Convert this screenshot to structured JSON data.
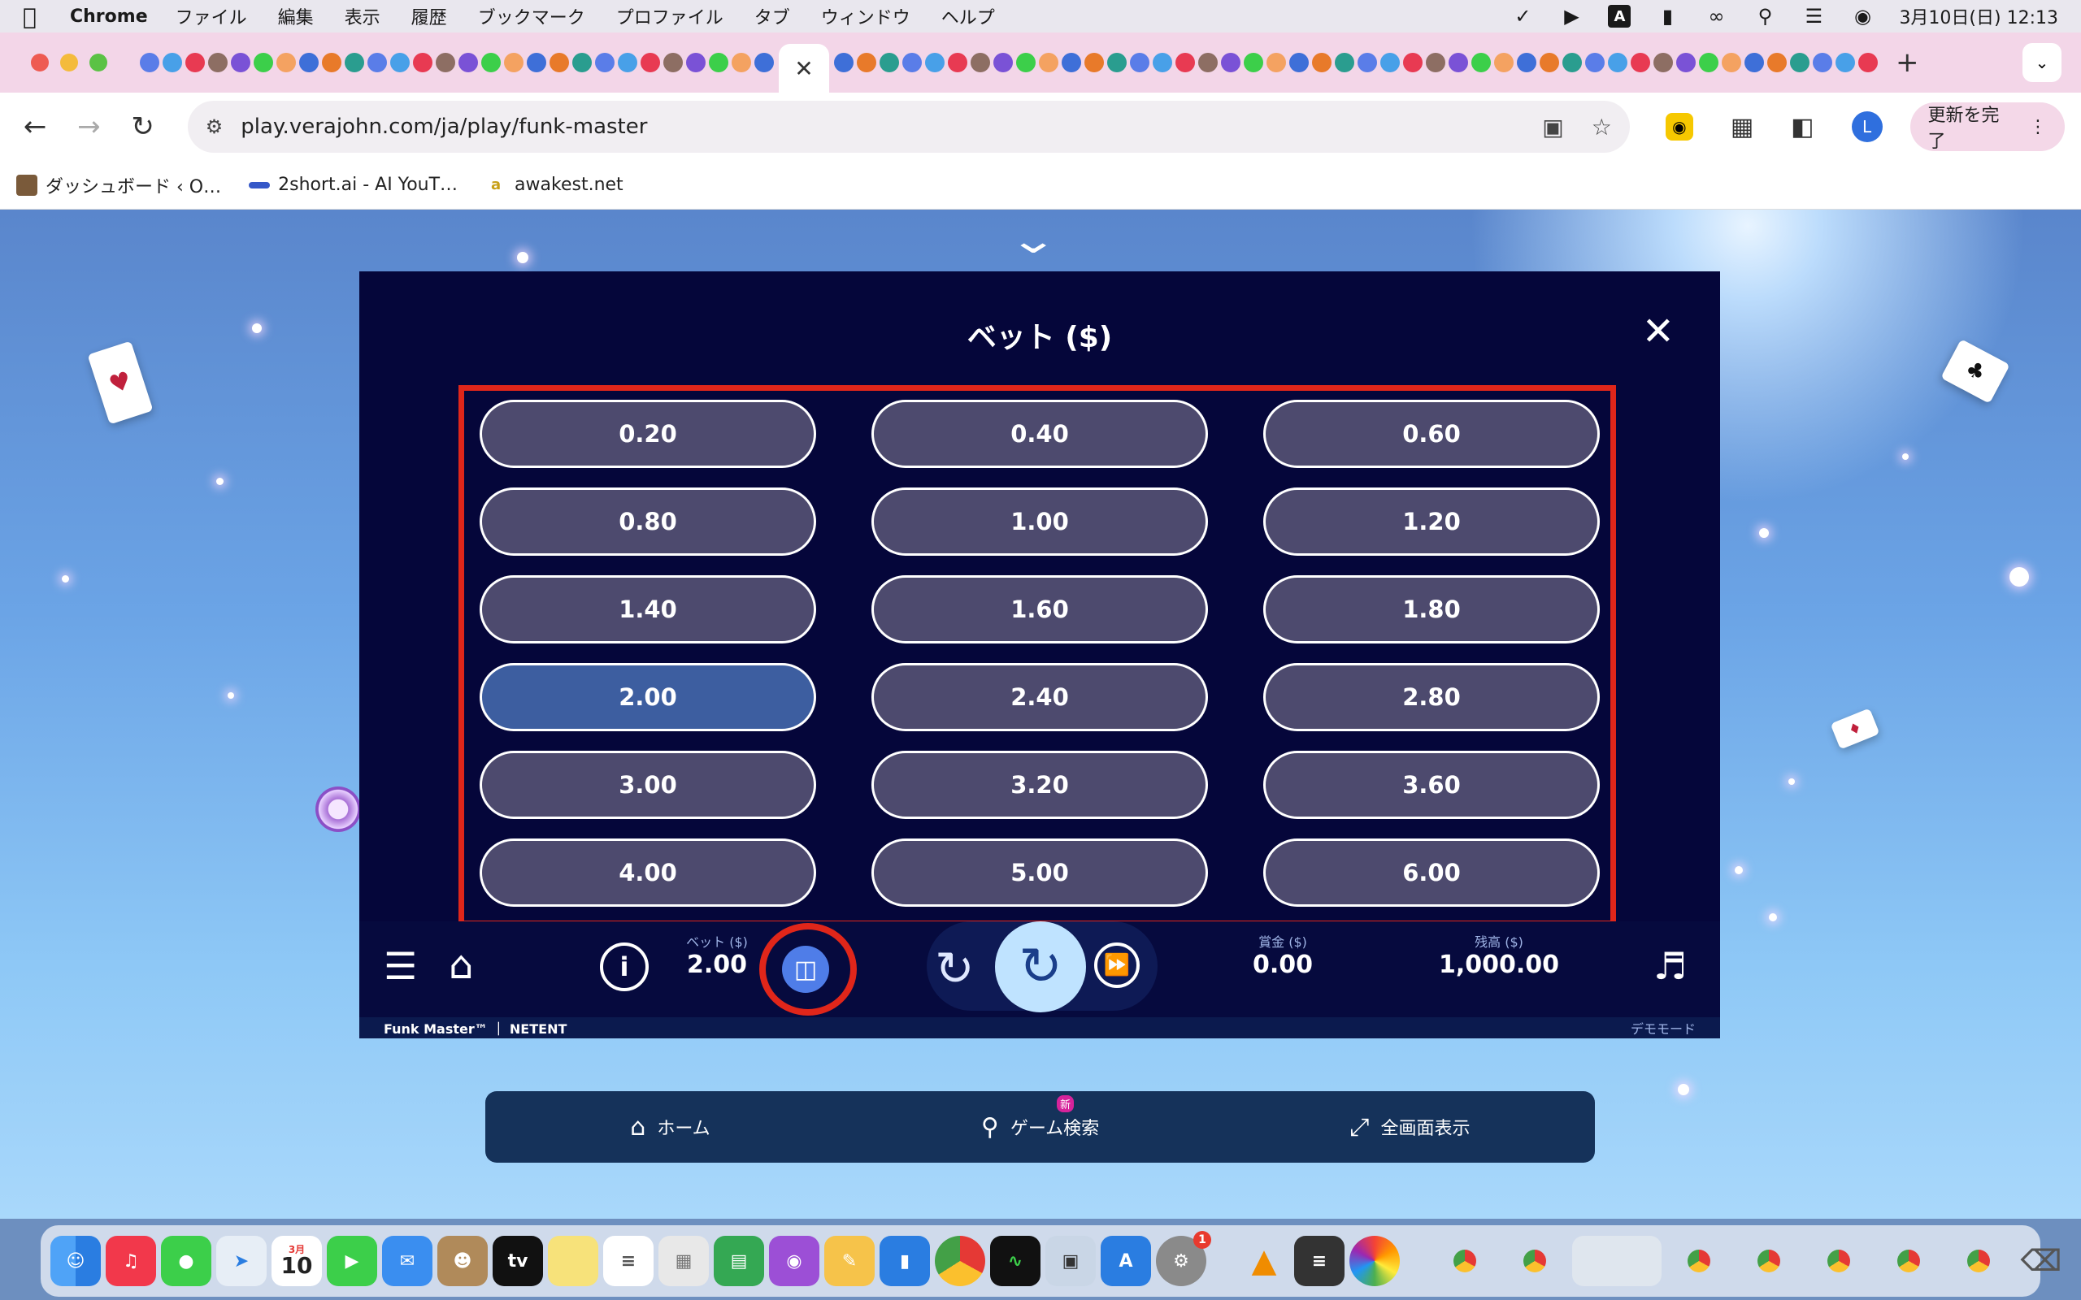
{
  "menubar": {
    "app": "Chrome",
    "items": [
      "ファイル",
      "編集",
      "表示",
      "履歴",
      "ブックマーク",
      "プロファイル",
      "タブ",
      "ウィンドウ",
      "ヘルプ"
    ],
    "status_a": "A",
    "datetime": "3月10日(日)  12:13"
  },
  "browser": {
    "active_tab_close": "✕",
    "url": "play.verajohn.com/ja/play/funk-master",
    "update_button": "更新を完了",
    "profile_initial": "L"
  },
  "bookmarks": [
    {
      "label": "ダッシュボード ‹ O…",
      "icon": "dashboard-icon",
      "color": "#7a5a3a"
    },
    {
      "label": "2short.ai - AI YouT…",
      "icon": "2short-icon",
      "color": "#3558c8"
    },
    {
      "label": "awakest.net",
      "icon": "awakest-icon",
      "color": "#c8a018"
    }
  ],
  "game": {
    "title": "ベット ($)",
    "bet_options": [
      "0.20",
      "0.40",
      "0.60",
      "0.80",
      "1.00",
      "1.20",
      "1.40",
      "1.60",
      "1.80",
      "2.00",
      "2.40",
      "2.80",
      "3.00",
      "3.20",
      "3.60",
      "4.00",
      "5.00",
      "6.00"
    ],
    "selected_bet": "2.00",
    "bet_label": "ベット ($)",
    "bet_value": "2.00",
    "win_label": "賞金 ($)",
    "win_value": "0.00",
    "balance_label": "残高 ($)",
    "balance_value": "1,000.00",
    "game_name": "Funk Master™ ｜ NETENT",
    "mode": "デモモード",
    "highlight_color": "#e0261a"
  },
  "site_nav": {
    "home": "ホーム",
    "search": "ゲーム検索",
    "new_badge": "新",
    "fullscreen": "全画面表示"
  },
  "dock": {
    "calendar_month": "3月",
    "calendar_day": "10",
    "tv_label": "tv",
    "settings_badge": "1"
  }
}
